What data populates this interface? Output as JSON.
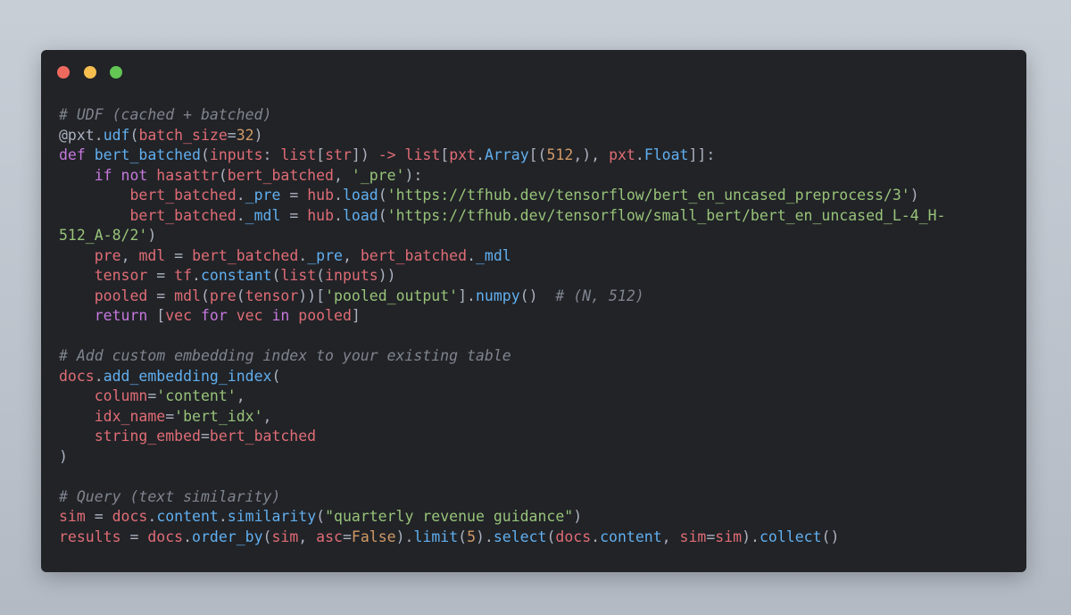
{
  "colors": {
    "close": "#ee6a5f",
    "minimize": "#f5be4f",
    "maximize": "#62c554",
    "window_bg": "#212327"
  },
  "code_lines": [
    [
      {
        "t": "# UDF (cached + batched)",
        "k": "comment"
      }
    ],
    [
      {
        "t": "@pxt",
        "k": "plain"
      },
      {
        "t": ".",
        "k": "plain"
      },
      {
        "t": "udf",
        "k": "func"
      },
      {
        "t": "(",
        "k": "plain"
      },
      {
        "t": "batch_size",
        "k": "param"
      },
      {
        "t": "=",
        "k": "plain"
      },
      {
        "t": "32",
        "k": "number"
      },
      {
        "t": ")",
        "k": "plain"
      }
    ],
    [
      {
        "t": "def ",
        "k": "keyword"
      },
      {
        "t": "bert_batched",
        "k": "func"
      },
      {
        "t": "(",
        "k": "plain"
      },
      {
        "t": "inputs",
        "k": "param"
      },
      {
        "t": ": ",
        "k": "plain"
      },
      {
        "t": "list",
        "k": "var"
      },
      {
        "t": "[",
        "k": "plain"
      },
      {
        "t": "str",
        "k": "var"
      },
      {
        "t": "]) ",
        "k": "plain"
      },
      {
        "t": "->",
        "k": "var"
      },
      {
        "t": " ",
        "k": "plain"
      },
      {
        "t": "list",
        "k": "var"
      },
      {
        "t": "[",
        "k": "plain"
      },
      {
        "t": "pxt",
        "k": "var"
      },
      {
        "t": ".",
        "k": "plain"
      },
      {
        "t": "Array",
        "k": "func"
      },
      {
        "t": "[(",
        "k": "plain"
      },
      {
        "t": "512",
        "k": "number"
      },
      {
        "t": ",), ",
        "k": "plain"
      },
      {
        "t": "pxt",
        "k": "var"
      },
      {
        "t": ".",
        "k": "plain"
      },
      {
        "t": "Float",
        "k": "func"
      },
      {
        "t": "]]:",
        "k": "plain"
      }
    ],
    [
      {
        "t": "    ",
        "k": "plain"
      },
      {
        "t": "if not ",
        "k": "keyword"
      },
      {
        "t": "hasattr",
        "k": "var"
      },
      {
        "t": "(",
        "k": "plain"
      },
      {
        "t": "bert_batched",
        "k": "var"
      },
      {
        "t": ", ",
        "k": "plain"
      },
      {
        "t": "'_pre'",
        "k": "string"
      },
      {
        "t": "):",
        "k": "plain"
      }
    ],
    [
      {
        "t": "        ",
        "k": "plain"
      },
      {
        "t": "bert_batched",
        "k": "var"
      },
      {
        "t": ".",
        "k": "plain"
      },
      {
        "t": "_pre",
        "k": "func"
      },
      {
        "t": " = ",
        "k": "plain"
      },
      {
        "t": "hub",
        "k": "var"
      },
      {
        "t": ".",
        "k": "plain"
      },
      {
        "t": "load",
        "k": "func"
      },
      {
        "t": "(",
        "k": "plain"
      },
      {
        "t": "'https://tfhub.dev/tensorflow/bert_en_uncased_preprocess/3'",
        "k": "string"
      },
      {
        "t": ")",
        "k": "plain"
      }
    ],
    [
      {
        "t": "        ",
        "k": "plain"
      },
      {
        "t": "bert_batched",
        "k": "var"
      },
      {
        "t": ".",
        "k": "plain"
      },
      {
        "t": "_mdl",
        "k": "func"
      },
      {
        "t": " = ",
        "k": "plain"
      },
      {
        "t": "hub",
        "k": "var"
      },
      {
        "t": ".",
        "k": "plain"
      },
      {
        "t": "load",
        "k": "func"
      },
      {
        "t": "(",
        "k": "plain"
      },
      {
        "t": "'https://tfhub.dev/tensorflow/small_bert/bert_en_uncased_L-4_H-",
        "k": "string"
      }
    ],
    [
      {
        "t": "512_A-8/2'",
        "k": "string"
      },
      {
        "t": ")",
        "k": "plain"
      }
    ],
    [
      {
        "t": "    ",
        "k": "plain"
      },
      {
        "t": "pre",
        "k": "var"
      },
      {
        "t": ", ",
        "k": "plain"
      },
      {
        "t": "mdl",
        "k": "var"
      },
      {
        "t": " = ",
        "k": "plain"
      },
      {
        "t": "bert_batched",
        "k": "var"
      },
      {
        "t": ".",
        "k": "plain"
      },
      {
        "t": "_pre",
        "k": "func"
      },
      {
        "t": ", ",
        "k": "plain"
      },
      {
        "t": "bert_batched",
        "k": "var"
      },
      {
        "t": ".",
        "k": "plain"
      },
      {
        "t": "_mdl",
        "k": "func"
      }
    ],
    [
      {
        "t": "    ",
        "k": "plain"
      },
      {
        "t": "tensor",
        "k": "var"
      },
      {
        "t": " = ",
        "k": "plain"
      },
      {
        "t": "tf",
        "k": "var"
      },
      {
        "t": ".",
        "k": "plain"
      },
      {
        "t": "constant",
        "k": "func"
      },
      {
        "t": "(",
        "k": "plain"
      },
      {
        "t": "list",
        "k": "var"
      },
      {
        "t": "(",
        "k": "plain"
      },
      {
        "t": "inputs",
        "k": "var"
      },
      {
        "t": "))",
        "k": "plain"
      }
    ],
    [
      {
        "t": "    ",
        "k": "plain"
      },
      {
        "t": "pooled",
        "k": "var"
      },
      {
        "t": " = ",
        "k": "plain"
      },
      {
        "t": "mdl",
        "k": "var"
      },
      {
        "t": "(",
        "k": "plain"
      },
      {
        "t": "pre",
        "k": "var"
      },
      {
        "t": "(",
        "k": "plain"
      },
      {
        "t": "tensor",
        "k": "var"
      },
      {
        "t": "))[",
        "k": "plain"
      },
      {
        "t": "'pooled_output'",
        "k": "string"
      },
      {
        "t": "].",
        "k": "plain"
      },
      {
        "t": "numpy",
        "k": "func"
      },
      {
        "t": "()  ",
        "k": "plain"
      },
      {
        "t": "# (N, 512)",
        "k": "comment"
      }
    ],
    [
      {
        "t": "    ",
        "k": "plain"
      },
      {
        "t": "return ",
        "k": "keyword"
      },
      {
        "t": "[",
        "k": "plain"
      },
      {
        "t": "vec",
        "k": "var"
      },
      {
        "t": " for ",
        "k": "keyword"
      },
      {
        "t": "vec",
        "k": "var"
      },
      {
        "t": " in ",
        "k": "keyword"
      },
      {
        "t": "pooled",
        "k": "var"
      },
      {
        "t": "]",
        "k": "plain"
      }
    ],
    [],
    [
      {
        "t": "# Add custom embedding index to your existing table",
        "k": "comment"
      }
    ],
    [
      {
        "t": "docs",
        "k": "var"
      },
      {
        "t": ".",
        "k": "plain"
      },
      {
        "t": "add_embedding_index",
        "k": "func"
      },
      {
        "t": "(",
        "k": "plain"
      }
    ],
    [
      {
        "t": "    ",
        "k": "plain"
      },
      {
        "t": "column",
        "k": "param"
      },
      {
        "t": "=",
        "k": "plain"
      },
      {
        "t": "'content'",
        "k": "string"
      },
      {
        "t": ",",
        "k": "plain"
      }
    ],
    [
      {
        "t": "    ",
        "k": "plain"
      },
      {
        "t": "idx_name",
        "k": "param"
      },
      {
        "t": "=",
        "k": "plain"
      },
      {
        "t": "'bert_idx'",
        "k": "string"
      },
      {
        "t": ",",
        "k": "plain"
      }
    ],
    [
      {
        "t": "    ",
        "k": "plain"
      },
      {
        "t": "string_embed",
        "k": "param"
      },
      {
        "t": "=",
        "k": "plain"
      },
      {
        "t": "bert_batched",
        "k": "var"
      }
    ],
    [
      {
        "t": ")",
        "k": "plain"
      }
    ],
    [],
    [
      {
        "t": "# Query (text similarity)",
        "k": "comment"
      }
    ],
    [
      {
        "t": "sim",
        "k": "var"
      },
      {
        "t": " = ",
        "k": "plain"
      },
      {
        "t": "docs",
        "k": "var"
      },
      {
        "t": ".",
        "k": "plain"
      },
      {
        "t": "content",
        "k": "func"
      },
      {
        "t": ".",
        "k": "plain"
      },
      {
        "t": "similarity",
        "k": "func"
      },
      {
        "t": "(",
        "k": "plain"
      },
      {
        "t": "\"quarterly revenue guidance\"",
        "k": "string"
      },
      {
        "t": ")",
        "k": "plain"
      }
    ],
    [
      {
        "t": "results",
        "k": "var"
      },
      {
        "t": " = ",
        "k": "plain"
      },
      {
        "t": "docs",
        "k": "var"
      },
      {
        "t": ".",
        "k": "plain"
      },
      {
        "t": "order_by",
        "k": "func"
      },
      {
        "t": "(",
        "k": "plain"
      },
      {
        "t": "sim",
        "k": "var"
      },
      {
        "t": ", ",
        "k": "plain"
      },
      {
        "t": "asc",
        "k": "param"
      },
      {
        "t": "=",
        "k": "plain"
      },
      {
        "t": "False",
        "k": "number"
      },
      {
        "t": ").",
        "k": "plain"
      },
      {
        "t": "limit",
        "k": "func"
      },
      {
        "t": "(",
        "k": "plain"
      },
      {
        "t": "5",
        "k": "number"
      },
      {
        "t": ").",
        "k": "plain"
      },
      {
        "t": "select",
        "k": "func"
      },
      {
        "t": "(",
        "k": "plain"
      },
      {
        "t": "docs",
        "k": "var"
      },
      {
        "t": ".",
        "k": "plain"
      },
      {
        "t": "content",
        "k": "func"
      },
      {
        "t": ", ",
        "k": "plain"
      },
      {
        "t": "sim",
        "k": "param"
      },
      {
        "t": "=",
        "k": "plain"
      },
      {
        "t": "sim",
        "k": "var"
      },
      {
        "t": ").",
        "k": "plain"
      },
      {
        "t": "collect",
        "k": "func"
      },
      {
        "t": "()",
        "k": "plain"
      }
    ]
  ]
}
